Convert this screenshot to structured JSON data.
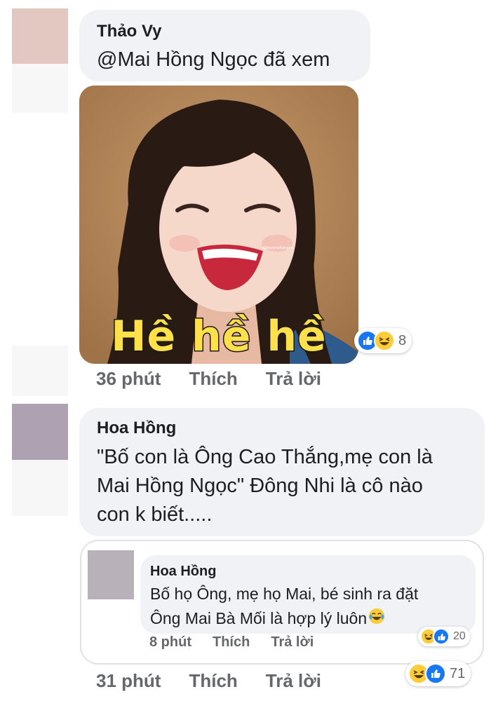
{
  "comments": [
    {
      "author": "Thảo Vy",
      "text": "@Mai Hồng Ngọc đã xem",
      "image_caption": "Hề hề hề",
      "image_watermark": "@beyuhaitangen",
      "reactions": {
        "icons": [
          "like-icon",
          "haha-icon"
        ],
        "count": "8"
      },
      "time": "36 phút",
      "like_label": "Thích",
      "reply_label": "Trả lời"
    },
    {
      "author": "Hoa Hồng",
      "text_lines": [
        "\"Bố con là Ông Cao Thắng,mẹ con là",
        "Mai Hồng Ngọc\" Đông Nhi là cô nào",
        "con k biết....."
      ],
      "reactions": {
        "icons": [
          "haha-icon",
          "like-icon"
        ],
        "count": "71"
      },
      "time": "31 phút",
      "like_label": "Thích",
      "reply_label": "Trả lời",
      "reply": {
        "author": "Hoa Hồng",
        "text_lines": [
          "Bố họ Ông, mẹ họ Mai, bé sinh ra đặt",
          "Ông Mai Bà Mối là hợp lý luôn"
        ],
        "emoji": "tears-of-joy-icon",
        "reactions": {
          "icons": [
            "haha-icon",
            "like-icon"
          ],
          "count": "20"
        },
        "time": "8 phút",
        "like_label": "Thích",
        "reply_label": "Trả lời"
      }
    }
  ],
  "colors": {
    "avatar_1": "#e2c8c0",
    "avatar_2": "#aea2b2",
    "avatar_3": "#b9b1ba",
    "bubble": "#f0f2f5",
    "meta_text": "#65676b",
    "like_blue": "#1877f2",
    "haha_yellow": "#fbcd3b"
  }
}
